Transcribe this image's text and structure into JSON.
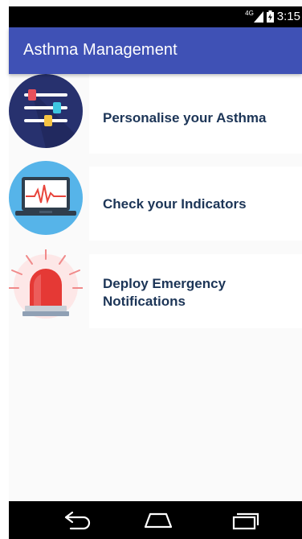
{
  "status_bar": {
    "network": "4G",
    "time": "3:15"
  },
  "app_bar": {
    "title": "Asthma Management"
  },
  "menu": {
    "items": [
      {
        "label": "Personalise your Asthma",
        "icon": "settings-sliders-icon"
      },
      {
        "label": "Check your Indicators",
        "icon": "heartbeat-laptop-icon"
      },
      {
        "label_line1": "Deploy Emergency",
        "label_line2": "Notifications",
        "icon": "emergency-siren-icon"
      }
    ]
  },
  "navigation": {
    "buttons": [
      "back",
      "home",
      "recent-apps"
    ]
  },
  "colors": {
    "primary": "#3f51b5",
    "label_text": "#1c3557",
    "background": "#fafafa"
  }
}
